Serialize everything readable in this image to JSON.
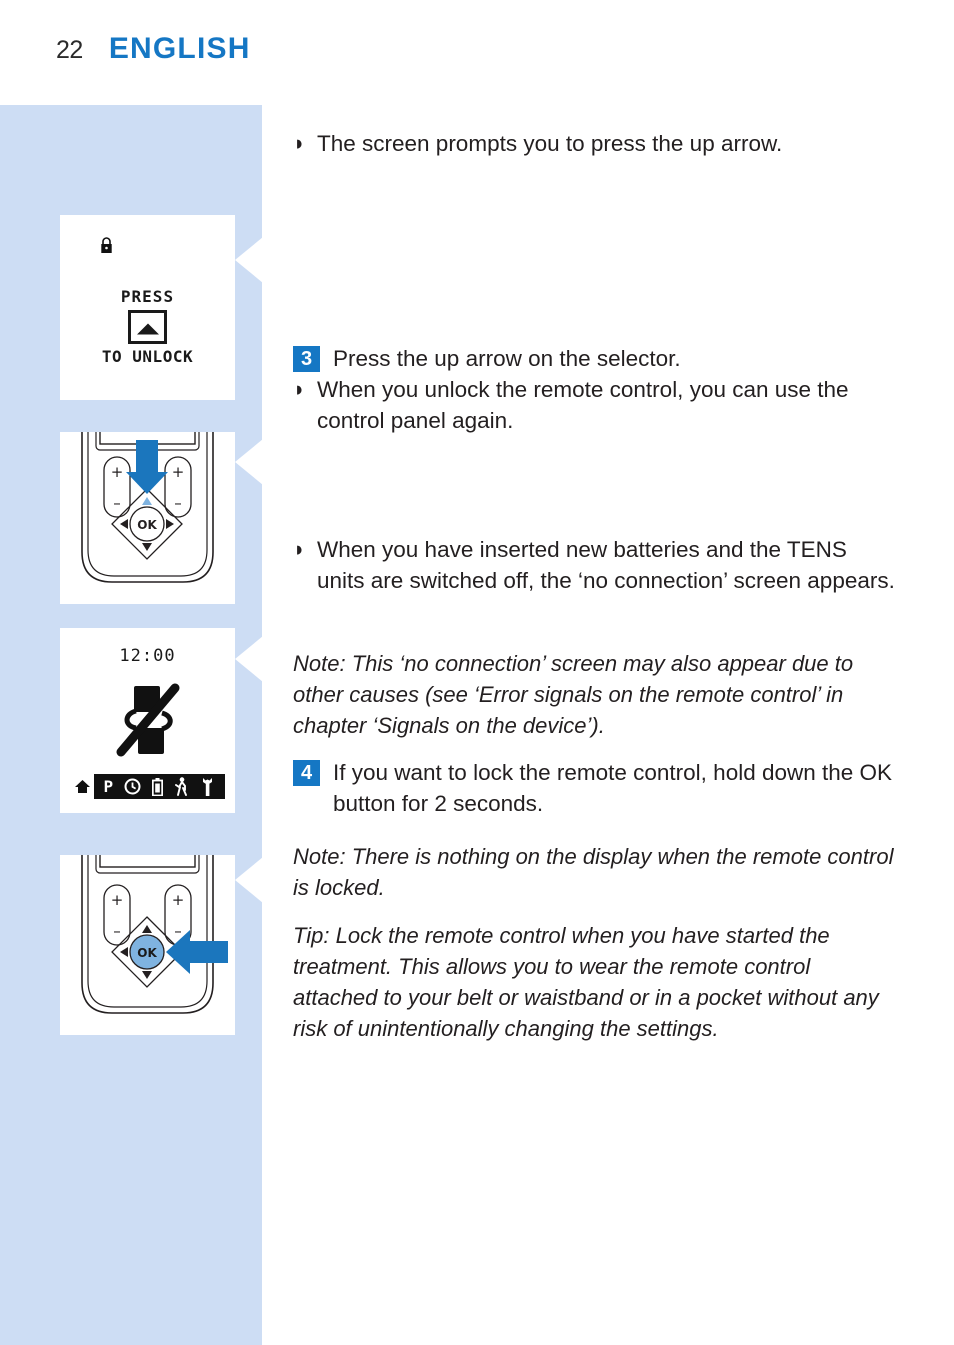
{
  "header": {
    "page_number": "22",
    "chapter": "ENGLISH",
    "chapter_color": "#1577c4"
  },
  "theme": {
    "band_background": "#cdddf4",
    "accent_blue": "#1577c4",
    "arrow_blue": "#1b76bd",
    "text_color": "#231f20"
  },
  "figures": [
    {
      "name": "lcd-unlock-prompt",
      "type": "lcd-screen",
      "lock_icon": " ",
      "press_label": "PRESS",
      "key_icon": "up-arrow-key",
      "unlock_label": "TO UNLOCK"
    },
    {
      "name": "remote-up-arrow",
      "type": "remote-control",
      "callout_arrow": "down-arrow",
      "highlighted_control": "up-arrow",
      "ok_label": "OK",
      "plus_label": "+",
      "minus_label": "−"
    },
    {
      "name": "lcd-no-connection",
      "type": "lcd-screen",
      "time": "12:00",
      "main_icon": "no-connection-icon",
      "status_icons": [
        "home-icon",
        "program-icon",
        "clock-icon",
        "battery-icon",
        "activity-icon",
        "wrench-icon"
      ],
      "program_label": "P"
    },
    {
      "name": "remote-ok-button",
      "type": "remote-control",
      "callout_arrow": "left-arrow",
      "highlighted_control": "ok-button",
      "ok_label": "OK",
      "plus_label": "+",
      "minus_label": "−"
    }
  ],
  "content": {
    "bullet_mark": "◗",
    "blocks": [
      {
        "id": "bullet-screen-prompt",
        "kind": "bullet",
        "text": "The screen prompts you to press the up arrow."
      },
      {
        "id": "step-3",
        "kind": "step",
        "number": "3",
        "text": "Press the up arrow on the selector."
      },
      {
        "id": "bullet-unlock-panel",
        "kind": "bullet",
        "text": "When you unlock the remote control, you can use the control panel again."
      },
      {
        "id": "bullet-no-connection",
        "kind": "bullet",
        "text": "When you have inserted new batteries and the TENS units are switched off, the ‘no connection’ screen appears."
      },
      {
        "id": "note-no-connection",
        "kind": "note",
        "text": "Note: This ‘no connection’ screen may also appear due to other causes (see ‘Error signals on the remote control’ in chapter ‘Signals on the device’)."
      },
      {
        "id": "step-4",
        "kind": "step",
        "number": "4",
        "text": "If you want to lock the remote control, hold down the OK button for 2 seconds."
      },
      {
        "id": "note-locked-display",
        "kind": "note",
        "text": "Note: There is nothing on the display when the remote control is locked."
      },
      {
        "id": "tip-lock-remote",
        "kind": "note",
        "text": "Tip: Lock the remote control when you have started the treatment. This allows you to wear the remote control attached to your belt or waistband or in a pocket without any risk of unintentionally changing the settings."
      }
    ]
  }
}
